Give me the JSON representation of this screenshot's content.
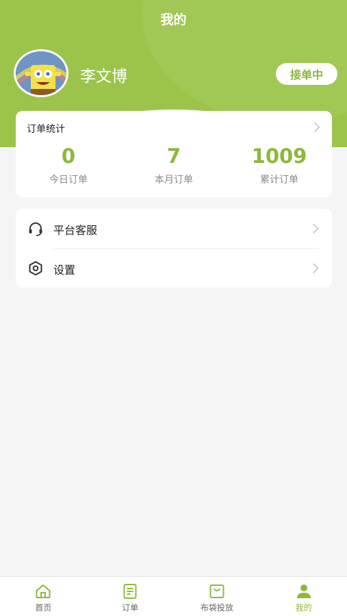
{
  "header": {
    "title": "我的"
  },
  "user": {
    "name": "李文博",
    "status": "接单中"
  },
  "stats": {
    "title": "订单统计",
    "items": [
      {
        "value": "0",
        "label": "今日订单"
      },
      {
        "value": "7",
        "label": "本月订单"
      },
      {
        "value": "1009",
        "label": "累计订单"
      }
    ]
  },
  "menu": [
    {
      "label": "平台客服",
      "icon": "headset-icon"
    },
    {
      "label": "设置",
      "icon": "settings-hexagon-icon"
    }
  ],
  "tabbar": [
    {
      "label": "首页",
      "icon": "home-icon",
      "active": false
    },
    {
      "label": "订单",
      "icon": "order-doc-icon",
      "active": false
    },
    {
      "label": "布袋投放",
      "icon": "bag-icon",
      "active": false
    },
    {
      "label": "我的",
      "icon": "user-icon",
      "active": true
    }
  ],
  "colors": {
    "accent": "#9cc44a",
    "accent_text": "#8db83c",
    "background": "#f5f5f5"
  }
}
